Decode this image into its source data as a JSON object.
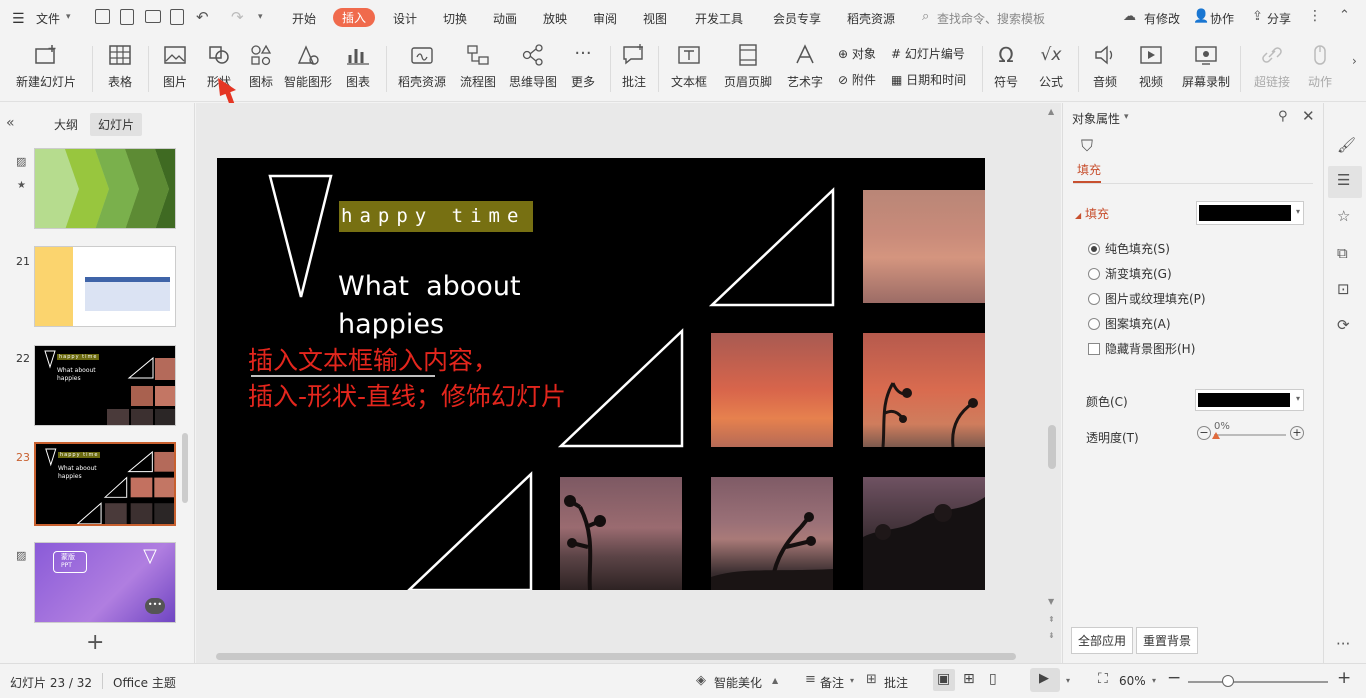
{
  "menubar": {
    "file": "文件",
    "tabs": [
      "开始",
      "插入",
      "设计",
      "切换",
      "动画",
      "放映",
      "审阅",
      "视图",
      "开发工具",
      "会员专享",
      "稻壳资源"
    ],
    "search_placeholder": "查找命令、搜索模板",
    "modified": "有修改",
    "collab": "协作",
    "share": "分享"
  },
  "ribbon": {
    "new_slide": "新建幻灯片",
    "table": "表格",
    "picture": "图片",
    "shape": "形状",
    "icon": "图标",
    "smart_shape": "智能图形",
    "chart": "图表",
    "docer": "稻壳资源",
    "flowchart": "流程图",
    "mindmap": "思维导图",
    "more": "更多",
    "comment": "批注",
    "textbox": "文本框",
    "header_footer": "页眉页脚",
    "wordart": "艺术字",
    "object": "对象",
    "attachment": "附件",
    "slide_number": "幻灯片编号",
    "datetime": "日期和时间",
    "symbol": "符号",
    "formula": "公式",
    "audio": "音频",
    "video": "视频",
    "screen_record": "屏幕录制",
    "hyperlink": "超链接",
    "action": "动作"
  },
  "leftpanel": {
    "outline_tab": "大纲",
    "slides_tab": "幻灯片",
    "slide_numbers": [
      "21",
      "22",
      "23"
    ],
    "thumb22": {
      "tag": "happy time",
      "line1": "What aboout",
      "line2": "happies"
    },
    "thumb23": {
      "tag": "happy time",
      "line1": "What aboout",
      "line2": "happies"
    },
    "thumb24": {
      "line1": "蒙版",
      "line2": "PPT"
    },
    "add": "+"
  },
  "slide": {
    "tag": "happy time",
    "line1": "What  aboout",
    "line2": "happies",
    "annotation1": "插入文本框输入内容，",
    "annotation2": "插入-形状-直线；修饰幻灯片"
  },
  "rightpane": {
    "title": "对象属性",
    "tab": "填充",
    "section": "填充",
    "options": [
      "纯色填充(S)",
      "渐变填充(G)",
      "图片或纹理填充(P)",
      "图案填充(A)"
    ],
    "hide_bg": "隐藏背景图形(H)",
    "color_label": "颜色(C)",
    "transparency_label": "透明度(T)",
    "transparency_value": "0%",
    "apply_all": "全部应用",
    "reset_bg": "重置背景",
    "fill_color": "#000000"
  },
  "statusbar": {
    "slide_info": "幻灯片 23 / 32",
    "theme": "Office 主题",
    "beautify": "智能美化",
    "notes": "备注",
    "comment": "批注",
    "zoom": "60%"
  }
}
